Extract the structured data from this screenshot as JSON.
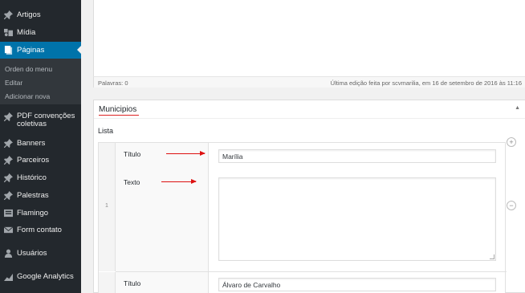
{
  "sidebar": {
    "items": [
      {
        "label": "Artigos",
        "icon": "pin-icon"
      },
      {
        "label": "Mídia",
        "icon": "media-icon"
      },
      {
        "label": "Páginas",
        "icon": "pages-icon",
        "active": true
      },
      {
        "label": "PDF convenções coletivas",
        "icon": "pin-icon"
      },
      {
        "label": "Banners",
        "icon": "pin-icon"
      },
      {
        "label": "Parceiros",
        "icon": "pin-icon"
      },
      {
        "label": "Histórico",
        "icon": "pin-icon"
      },
      {
        "label": "Palestras",
        "icon": "pin-icon"
      },
      {
        "label": "Flamingo",
        "icon": "flamingo-icon"
      },
      {
        "label": "Form contato",
        "icon": "mail-icon"
      },
      {
        "label": "Usuários",
        "icon": "users-icon"
      },
      {
        "label": "Google Analytics",
        "icon": "analytics-icon"
      }
    ],
    "submenu": [
      "Orden do menu",
      "Editar",
      "Adicionar nova"
    ],
    "colors": {
      "bg": "#23282d",
      "active": "#0073aa",
      "submenu_bg": "#32373c"
    }
  },
  "editor": {
    "word_count": "Palavras: 0",
    "last_edited": "Última edição feita por scvmarilia, em 16 de setembro de 2016 às 11:16"
  },
  "metabox": {
    "title": "Municipios",
    "list_label": "Lista",
    "rows": [
      {
        "index": "1",
        "titulo_label": "Título",
        "titulo_value": "Marília",
        "texto_label": "Texto",
        "texto_value": ""
      },
      {
        "titulo_label": "Título",
        "titulo_value": "Álvaro de Carvalho"
      }
    ],
    "add_symbol": "+",
    "remove_symbol": "−",
    "toggle_symbol": "▲"
  },
  "accent": "#d11"
}
